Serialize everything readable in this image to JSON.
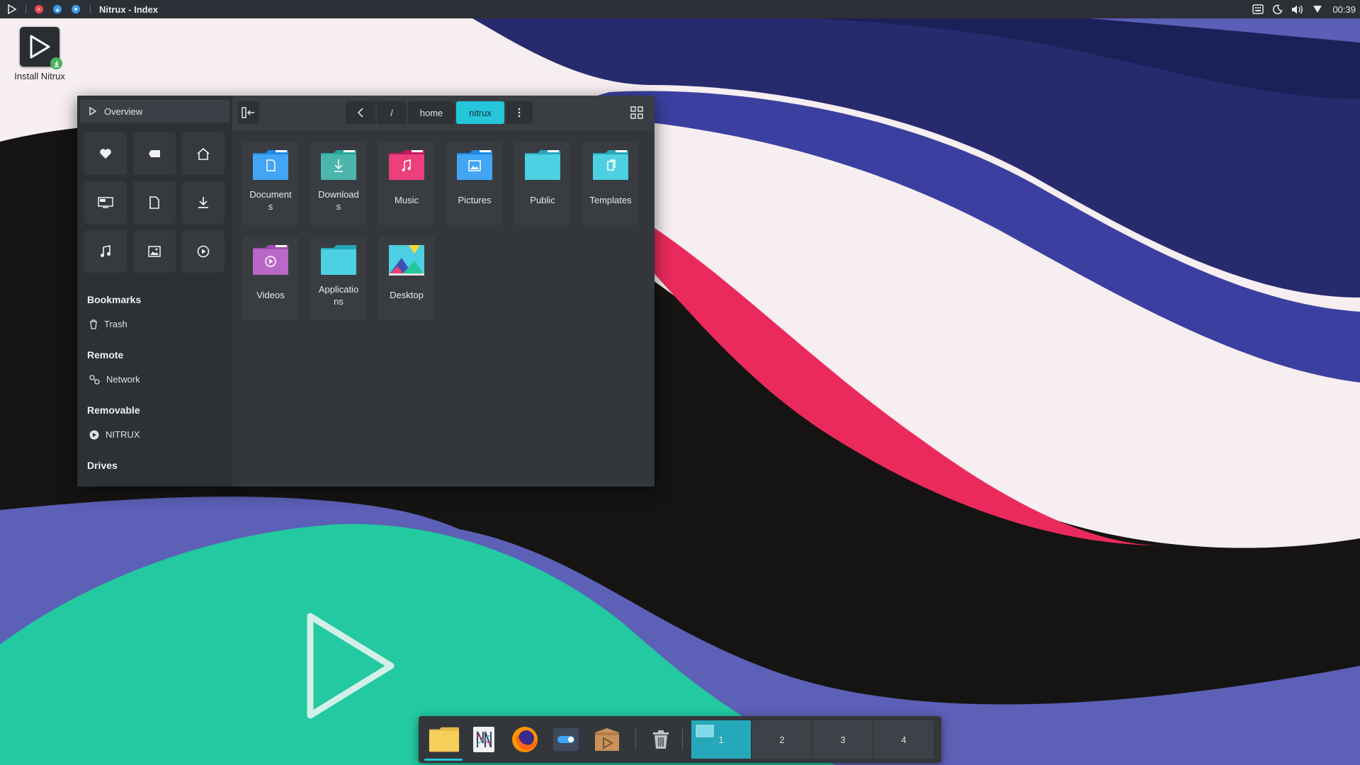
{
  "topbar": {
    "window_title": "Nitrux - Index",
    "clock": "00:39",
    "icons": [
      "launcher-icon",
      "close-dot-icon",
      "minimize-dot-icon",
      "maximize-dot-icon",
      "keyboard-icon",
      "night-mode-icon",
      "volume-icon",
      "network-icon"
    ]
  },
  "desktop": {
    "install_icon_label": "Install Nitrux"
  },
  "file_manager": {
    "sidebar": {
      "overview_label": "Overview",
      "quick_access": [
        "favorites-icon",
        "tags-icon",
        "home-icon",
        "desktop-icon",
        "documents-icon",
        "downloads-icon",
        "music-icon",
        "pictures-icon",
        "videos-icon"
      ],
      "sections": [
        {
          "title": "Bookmarks",
          "items": [
            {
              "label": "Trash",
              "icon": "trash-icon"
            }
          ]
        },
        {
          "title": "Remote",
          "items": [
            {
              "label": "Network",
              "icon": "network-icon"
            }
          ]
        },
        {
          "title": "Removable",
          "items": [
            {
              "label": "NITRUX",
              "icon": "drive-icon"
            }
          ]
        },
        {
          "title": "Drives",
          "items": []
        }
      ]
    },
    "toolbar": {
      "breadcrumbs": [
        "/",
        "home",
        "nitrux"
      ],
      "active_crumb": "nitrux"
    },
    "folders": [
      {
        "name": "Documents",
        "display": "Document\ns",
        "color": "#42a5f5",
        "icon": "documents-folder-icon"
      },
      {
        "name": "Downloads",
        "display": "Download\ns",
        "color": "#4db6ac",
        "icon": "downloads-folder-icon"
      },
      {
        "name": "Music",
        "display": "Music",
        "color": "#ec407a",
        "icon": "music-folder-icon"
      },
      {
        "name": "Pictures",
        "display": "Pictures",
        "color": "#42a5f5",
        "icon": "pictures-folder-icon"
      },
      {
        "name": "Public",
        "display": "Public",
        "color": "#4dd0e1",
        "icon": "public-folder-icon"
      },
      {
        "name": "Templates",
        "display": "Templates",
        "color": "#4dd0e1",
        "icon": "templates-folder-icon"
      },
      {
        "name": "Videos",
        "display": "Videos",
        "color": "#ba68c8",
        "icon": "videos-folder-icon"
      },
      {
        "name": "Applications",
        "display": "Applicatio\nns",
        "color": "#4dd0e1",
        "icon": "applications-folder-icon"
      },
      {
        "name": "Desktop",
        "display": "Desktop",
        "color": "#4dd0e1",
        "icon": "desktop-folder-icon"
      }
    ]
  },
  "dock": {
    "apps": [
      "file-manager-icon",
      "nitrux-notes-icon",
      "firefox-icon",
      "settings-toggle-icon",
      "software-center-icon",
      "trash-icon"
    ],
    "workspaces": [
      "1",
      "2",
      "3",
      "4"
    ],
    "active_workspace": "1"
  },
  "colors": {
    "accent": "#26c6da",
    "panel_dark": "#2c3036",
    "window_bg": "#33373c"
  }
}
